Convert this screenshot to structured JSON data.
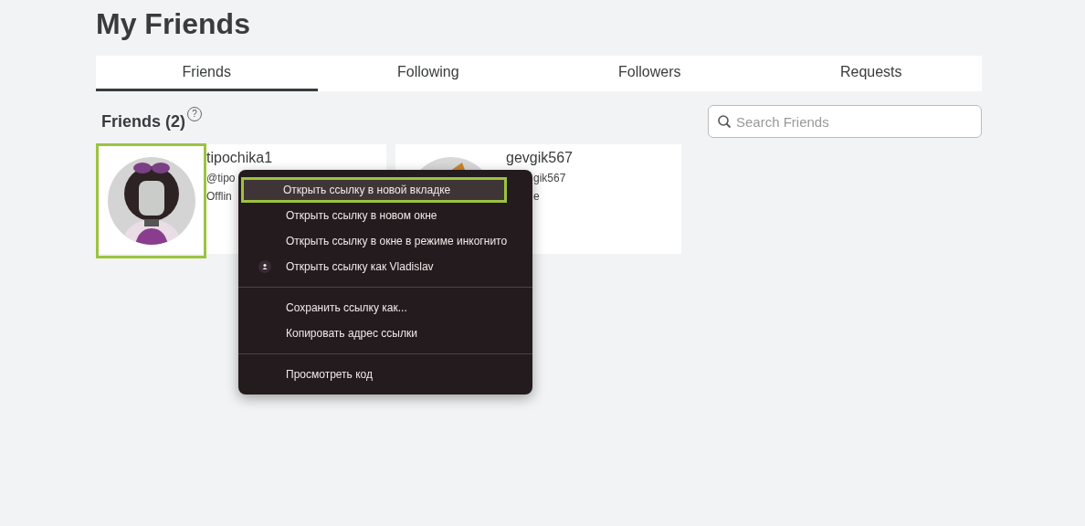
{
  "title": "My Friends",
  "tabs": [
    {
      "label": "Friends",
      "selected": true
    },
    {
      "label": "Following",
      "selected": false
    },
    {
      "label": "Followers",
      "selected": false
    },
    {
      "label": "Requests",
      "selected": false
    }
  ],
  "section": {
    "heading": "Friends (2)",
    "help": "?"
  },
  "search": {
    "placeholder": "Search Friends"
  },
  "friends": [
    {
      "name": "tipochika1",
      "handle": "@tipo",
      "status": "Offlin",
      "highlighted": true
    },
    {
      "name": "gevgik567",
      "handle": "gik567",
      "status": "e",
      "highlighted": false
    }
  ],
  "context_menu": {
    "items": [
      {
        "kind": "item",
        "label": "Открыть ссылку в новой вкладке",
        "selected": true
      },
      {
        "kind": "item",
        "label": "Открыть ссылку в новом окне",
        "selected": false
      },
      {
        "kind": "item",
        "label": "Открыть ссылку в окне в режиме инкогнито",
        "selected": false
      },
      {
        "kind": "profile",
        "label": "Открыть ссылку как Vladislav",
        "selected": false
      },
      {
        "kind": "separator"
      },
      {
        "kind": "item",
        "label": "Сохранить ссылку как...",
        "selected": false
      },
      {
        "kind": "item",
        "label": "Копировать адрес ссылки",
        "selected": false
      },
      {
        "kind": "separator"
      },
      {
        "kind": "item",
        "label": "Просмотреть код",
        "selected": false
      }
    ]
  }
}
